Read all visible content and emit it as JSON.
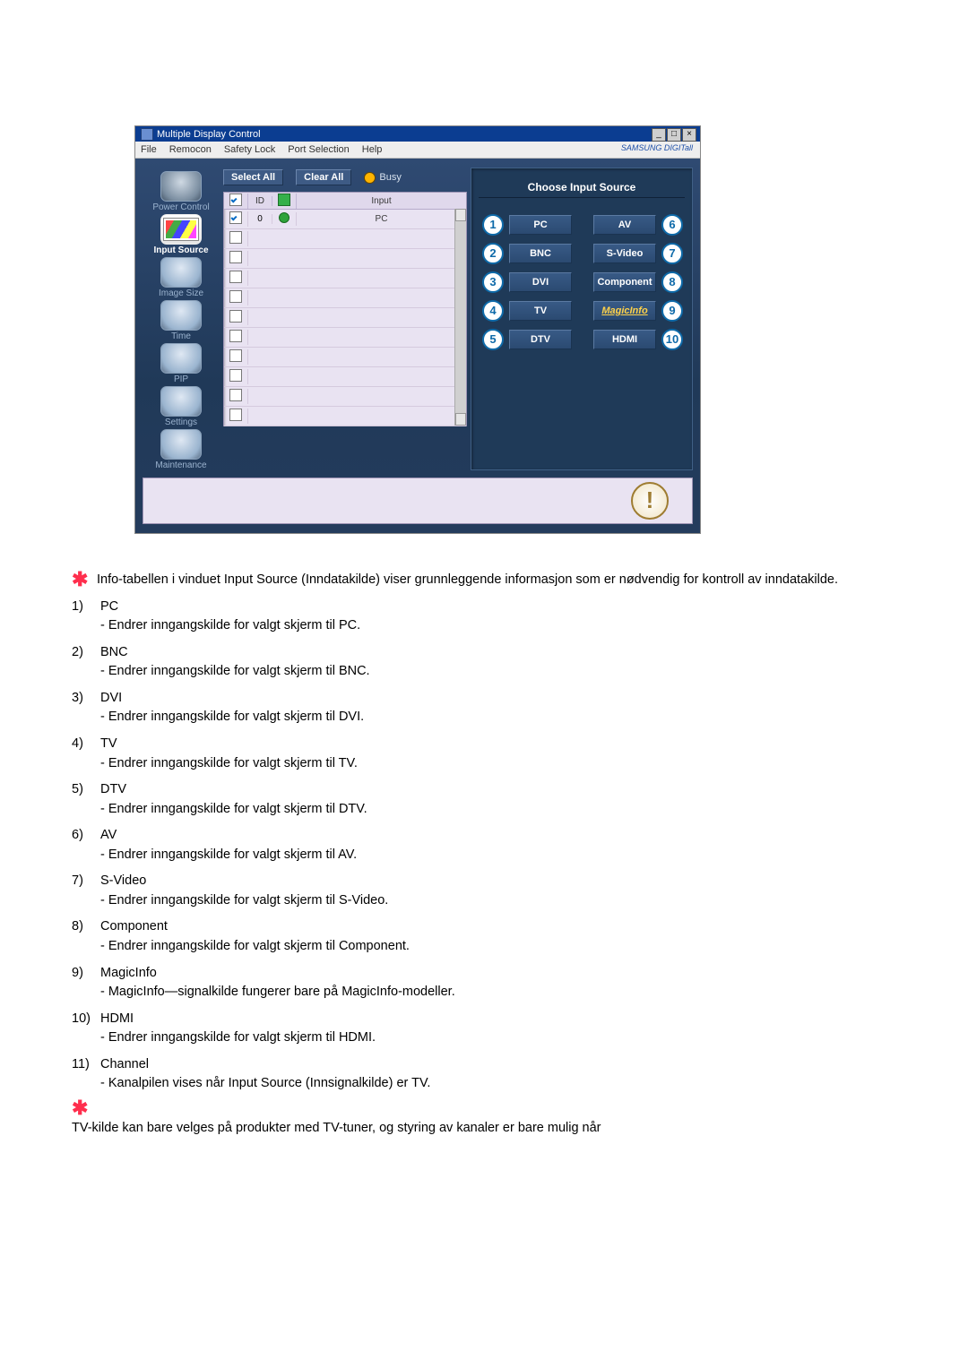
{
  "window": {
    "title": "Multiple Display Control",
    "menus": [
      "File",
      "Remocon",
      "Safety Lock",
      "Port Selection",
      "Help"
    ],
    "brand": "SAMSUNG DIGITall"
  },
  "sidebar": [
    {
      "key": "power",
      "label": "Power Control"
    },
    {
      "key": "input",
      "label": "Input Source",
      "active": true
    },
    {
      "key": "image",
      "label": "Image Size"
    },
    {
      "key": "time",
      "label": "Time"
    },
    {
      "key": "pip",
      "label": "PIP"
    },
    {
      "key": "settings",
      "label": "Settings"
    },
    {
      "key": "maint",
      "label": "Maintenance"
    }
  ],
  "toolbar": {
    "select_all": "Select All",
    "clear_all": "Clear All",
    "busy": "Busy"
  },
  "list": {
    "headers": {
      "id": "ID",
      "input": "Input"
    },
    "row0": {
      "id": "0",
      "input": "PC"
    }
  },
  "panel": {
    "heading": "Choose Input Source",
    "left": [
      {
        "n": "1",
        "label": "PC"
      },
      {
        "n": "2",
        "label": "BNC"
      },
      {
        "n": "3",
        "label": "DVI"
      },
      {
        "n": "4",
        "label": "TV"
      },
      {
        "n": "5",
        "label": "DTV"
      }
    ],
    "right": [
      {
        "n": "6",
        "label": "AV"
      },
      {
        "n": "7",
        "label": "S-Video"
      },
      {
        "n": "8",
        "label": "Component"
      },
      {
        "n": "9",
        "label": "MagicInfo",
        "magic": true
      },
      {
        "n": "10",
        "label": "HDMI"
      }
    ]
  },
  "intro": "Info-tabellen i vinduet Input Source (Inndatakilde) viser grunnleggende informasjon som er nødvendig for kontroll av inndatakilde.",
  "items": [
    {
      "num": "1)",
      "title": "PC",
      "desc": "- Endrer inngangskilde for valgt skjerm til PC."
    },
    {
      "num": "2)",
      "title": "BNC",
      "desc": "- Endrer inngangskilde for valgt skjerm til BNC."
    },
    {
      "num": "3)",
      "title": "DVI",
      "desc": "- Endrer inngangskilde for valgt skjerm til DVI."
    },
    {
      "num": "4)",
      "title": "TV",
      "desc": "- Endrer inngangskilde for valgt skjerm til TV."
    },
    {
      "num": "5)",
      "title": "DTV",
      "desc": "- Endrer inngangskilde for valgt skjerm til DTV."
    },
    {
      "num": "6)",
      "title": "AV",
      "desc": "- Endrer inngangskilde for valgt skjerm til AV."
    },
    {
      "num": "7)",
      "title": "S-Video",
      "desc": "- Endrer inngangskilde for valgt skjerm til S-Video."
    },
    {
      "num": "8)",
      "title": "Component",
      "desc": "- Endrer inngangskilde for valgt skjerm til Component."
    },
    {
      "num": "9)",
      "title": "MagicInfo",
      "desc": "- MagicInfo—signalkilde fungerer bare på MagicInfo-modeller."
    },
    {
      "num": "10)",
      "title": "HDMI",
      "desc": "- Endrer inngangskilde for valgt skjerm til HDMI."
    },
    {
      "num": "11)",
      "title": "Channel",
      "desc": "- Kanalpilen vises når Input Source (Innsignalkilde) er TV."
    }
  ],
  "footnote": "TV-kilde kan bare velges på produkter med TV-tuner, og styring av kanaler er bare mulig når"
}
